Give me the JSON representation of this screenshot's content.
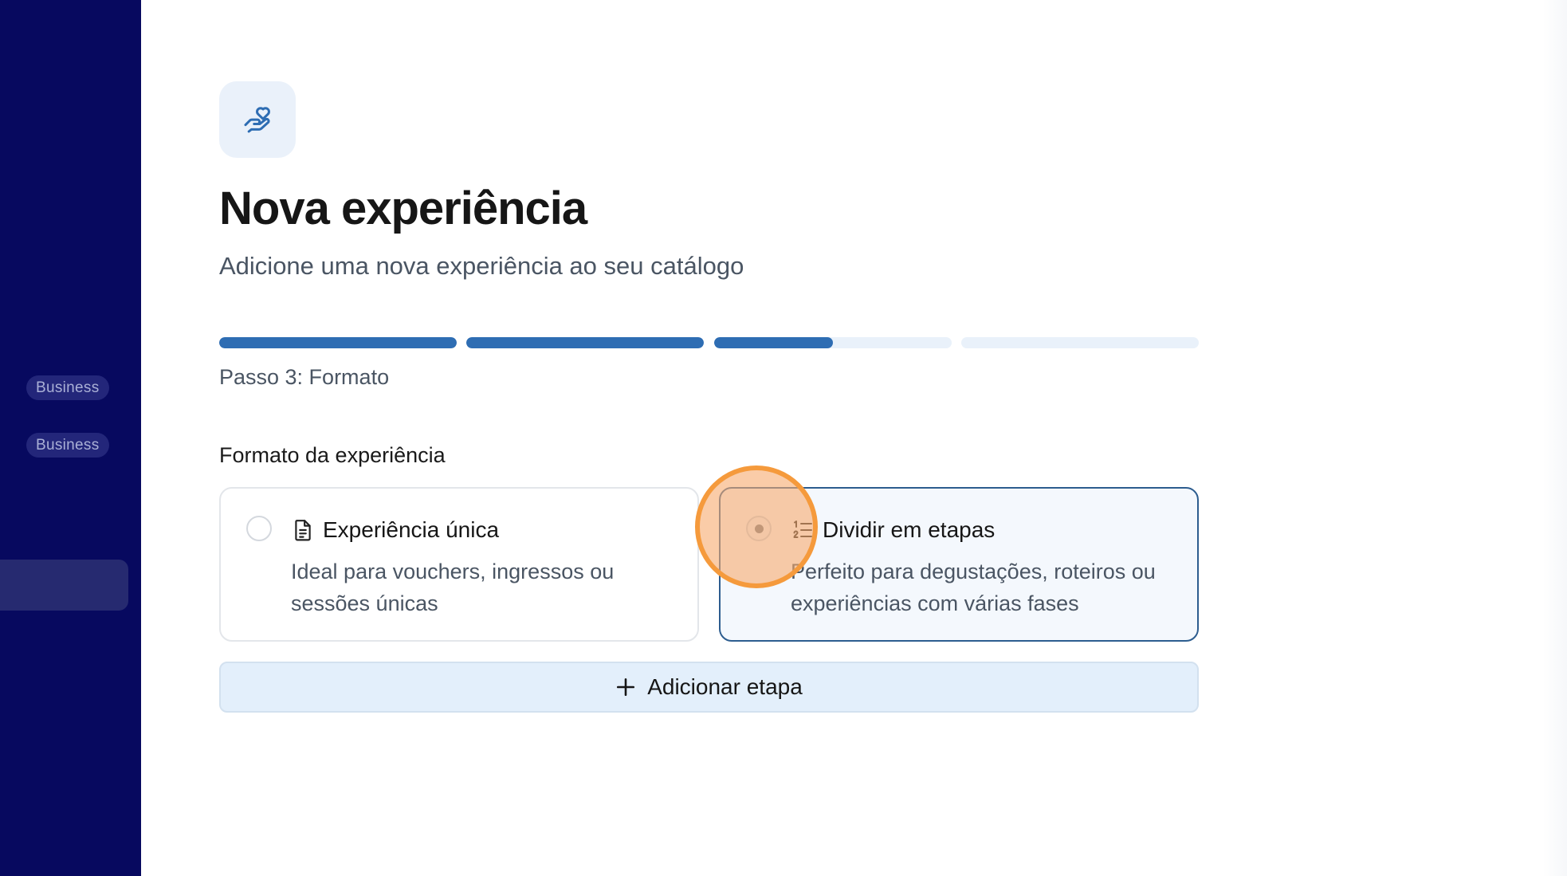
{
  "sidebar": {
    "badges": [
      "Business",
      "Business"
    ]
  },
  "header": {
    "title": "Nova experiência",
    "subtitle": "Adicione uma nova experiência ao seu catálogo",
    "icon": "hand-heart-icon"
  },
  "progress": {
    "segments": [
      1,
      1,
      0.5,
      0,
      0
    ],
    "step_label": "Passo 3: Formato"
  },
  "format": {
    "label": "Formato da experiência",
    "options": [
      {
        "title": "Experiência única",
        "description": "Ideal para vouchers, ingressos ou sessões únicas",
        "icon": "document-icon",
        "selected": false
      },
      {
        "title": "Dividir em etapas",
        "description": "Perfeito para degustações, roteiros ou experiências com várias fases",
        "icon": "numbered-list-icon",
        "selected": true
      }
    ]
  },
  "actions": {
    "add_step_label": "Adicionar etapa"
  },
  "colors": {
    "sidebar": "#07095f",
    "accent": "#2e6db3",
    "click_highlight": "#f59a3c"
  }
}
